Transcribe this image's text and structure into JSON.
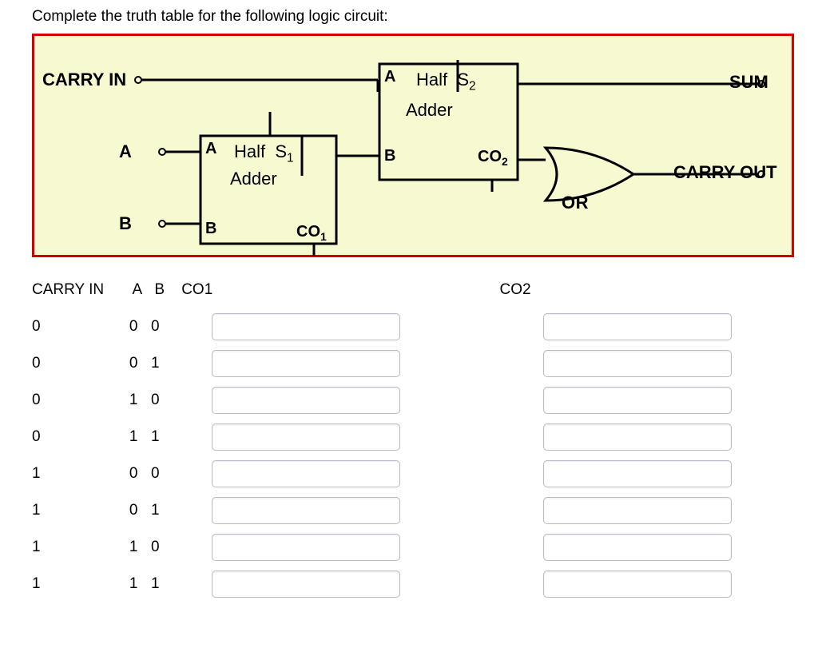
{
  "prompt": "Complete the truth table for the following logic circuit:",
  "circuit": {
    "carry_in": "CARRY IN",
    "A": "A",
    "B": "B",
    "ha1": {
      "A": "A",
      "B": "B",
      "text": "Half",
      "S": "S",
      "Ssub": "1",
      "adder": "Adder",
      "CO": "CO",
      "COsub": "1"
    },
    "ha2": {
      "A": "A",
      "B": "B",
      "text": "Half",
      "S": "S",
      "Ssub": "2",
      "adder": "Adder",
      "CO": "CO",
      "COsub": "2"
    },
    "or": "OR",
    "sum": "SUM",
    "carry_out": "CARRY OUT"
  },
  "headers": {
    "carry_in": "CARRY IN",
    "A": "A",
    "B": "B",
    "CO1": "CO1",
    "CO2": "CO2"
  },
  "rows": [
    {
      "cin": "0",
      "a": "0",
      "b": "0",
      "co1": "",
      "co2": ""
    },
    {
      "cin": "0",
      "a": "0",
      "b": "1",
      "co1": "",
      "co2": ""
    },
    {
      "cin": "0",
      "a": "1",
      "b": "0",
      "co1": "",
      "co2": ""
    },
    {
      "cin": "0",
      "a": "1",
      "b": "1",
      "co1": "",
      "co2": ""
    },
    {
      "cin": "1",
      "a": "0",
      "b": "0",
      "co1": "",
      "co2": ""
    },
    {
      "cin": "1",
      "a": "0",
      "b": "1",
      "co1": "",
      "co2": ""
    },
    {
      "cin": "1",
      "a": "1",
      "b": "0",
      "co1": "",
      "co2": ""
    },
    {
      "cin": "1",
      "a": "1",
      "b": "1",
      "co1": "",
      "co2": ""
    }
  ]
}
